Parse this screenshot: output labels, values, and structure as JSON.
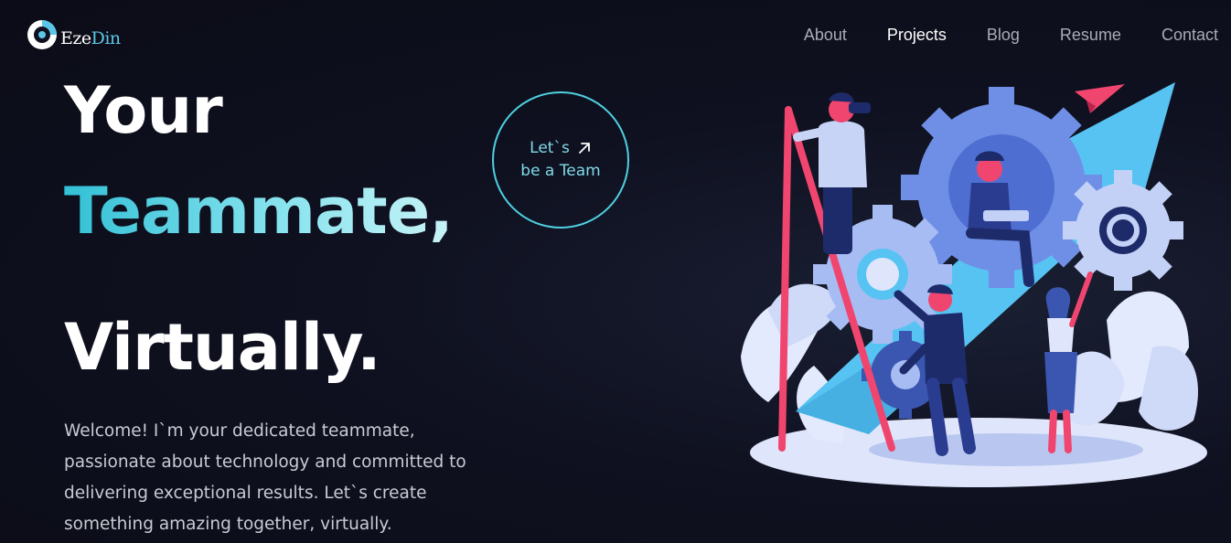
{
  "brand": {
    "part1": "Eze",
    "part2": "Din",
    "accent": "#5bc7e8"
  },
  "nav": {
    "items": [
      {
        "label": "About",
        "active": false
      },
      {
        "label": "Projects",
        "active": true
      },
      {
        "label": "Blog",
        "active": false
      },
      {
        "label": "Resume",
        "active": false
      },
      {
        "label": "Contact",
        "active": false
      }
    ]
  },
  "hero": {
    "line1": "Your",
    "line2": "Teammate,",
    "line3": "Virtually.",
    "cta_line1": "Let`s",
    "cta_line2": "be a Team",
    "cta_icon": "arrow-up-right-icon",
    "description": "Welcome! I`m your dedicated teammate, passionate about technology and committed to delivering exceptional results. Let`s create something amazing together, virtually."
  },
  "colors": {
    "background": "#0f1120",
    "accent_cyan": "#4fd0e0",
    "nav_inactive": "#a9acb6"
  },
  "illustration": {
    "name": "teamwork-gears-illustration"
  }
}
